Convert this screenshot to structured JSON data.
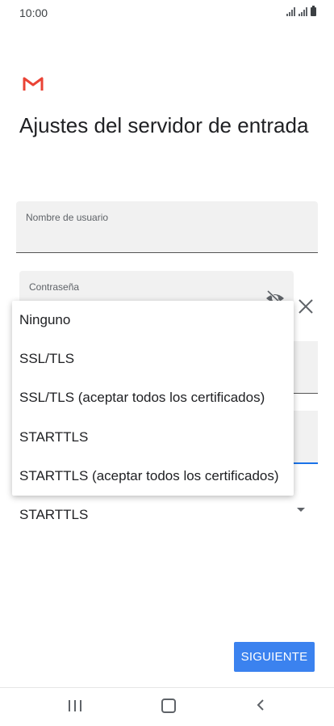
{
  "status_bar": {
    "time": "10:00"
  },
  "page": {
    "title": "Ajustes del servidor de entrada"
  },
  "username_field": {
    "label": "Nombre de usuario",
    "value": ""
  },
  "password_field": {
    "label": "Contraseña",
    "value": ""
  },
  "security_menu": {
    "options": [
      "Ninguno",
      "SSL/TLS",
      "SSL/TLS (aceptar todos los certificados)",
      "STARTTLS",
      "STARTTLS (aceptar todos los certificados)"
    ]
  },
  "security_select": {
    "selected": "STARTTLS"
  },
  "actions": {
    "next_label": "SIGUIENTE"
  },
  "colors": {
    "accent": "#1a73e8",
    "button": "#3b82ef",
    "gmail_red": "#ea4335"
  },
  "icons": [
    "gmail-logo",
    "eye-off-icon",
    "close-icon",
    "dropdown-arrow-icon",
    "recents-icon",
    "home-icon",
    "back-icon"
  ]
}
